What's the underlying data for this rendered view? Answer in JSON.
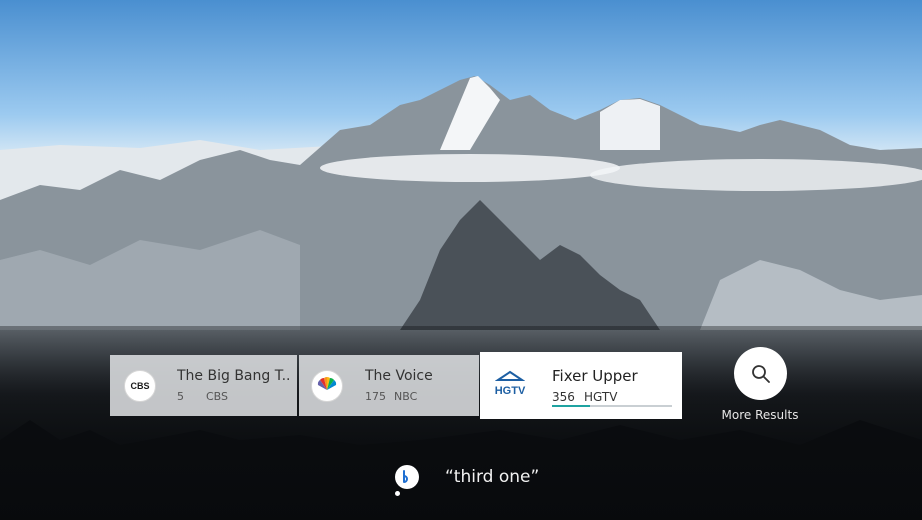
{
  "results": [
    {
      "title": "The Big Bang T...",
      "channel_number": "5",
      "network": "CBS",
      "logo_text": "CBS",
      "logo_icon": "cbs-eye-logo-icon"
    },
    {
      "title": "The Voice",
      "channel_number": "175",
      "network": "NBC",
      "logo_text": "NBC",
      "logo_icon": "nbc-peacock-logo-icon"
    },
    {
      "title": "Fixer Upper",
      "channel_number": "356",
      "network": "HGTV",
      "logo_text": "HGTV",
      "logo_icon": "hgtv-house-logo-icon",
      "progress": 0.32
    }
  ],
  "more_results": {
    "label": "More Results",
    "icon": "search-icon"
  },
  "voice": {
    "query": "“third one”",
    "icon": "bixby-icon"
  },
  "colors": {
    "accent": "#1fa3a1",
    "card_bg": "#dcdee0",
    "focused_bg": "#ffffff",
    "hgtv_blue": "#1d5fa3"
  }
}
